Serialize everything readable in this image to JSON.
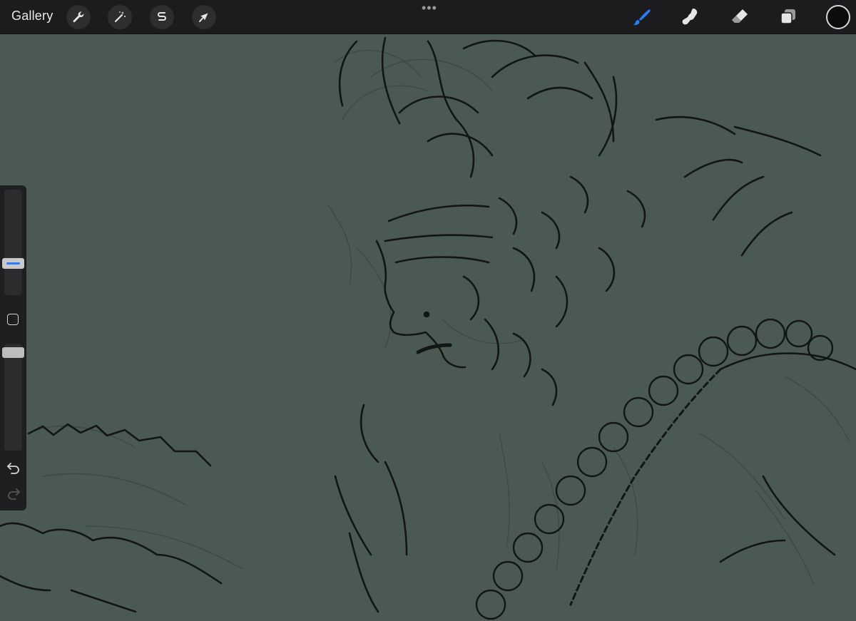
{
  "toolbar": {
    "gallery_label": "Gallery",
    "left_tools": [
      {
        "name": "actions",
        "icon": "wrench-icon"
      },
      {
        "name": "adjustments",
        "icon": "magic-wand-icon"
      },
      {
        "name": "selection",
        "icon": "selection-s-icon"
      },
      {
        "name": "transform",
        "icon": "arrow-cursor-icon"
      }
    ],
    "center_handle": "•••",
    "right_tools": [
      {
        "name": "brush",
        "icon": "brush-icon",
        "active": true
      },
      {
        "name": "smudge",
        "icon": "smudge-finger-icon",
        "active": false
      },
      {
        "name": "eraser",
        "icon": "eraser-icon",
        "active": false
      },
      {
        "name": "layers",
        "icon": "layers-icon",
        "active": false
      }
    ],
    "current_color": "#0c0c0c",
    "active_color": "#2a7df5"
  },
  "sidebar": {
    "brush_size_level": 0.28,
    "opacity_level": 0.96,
    "accent_color": "#2a7df5"
  },
  "canvas": {
    "background_color": "#4a5a53"
  }
}
